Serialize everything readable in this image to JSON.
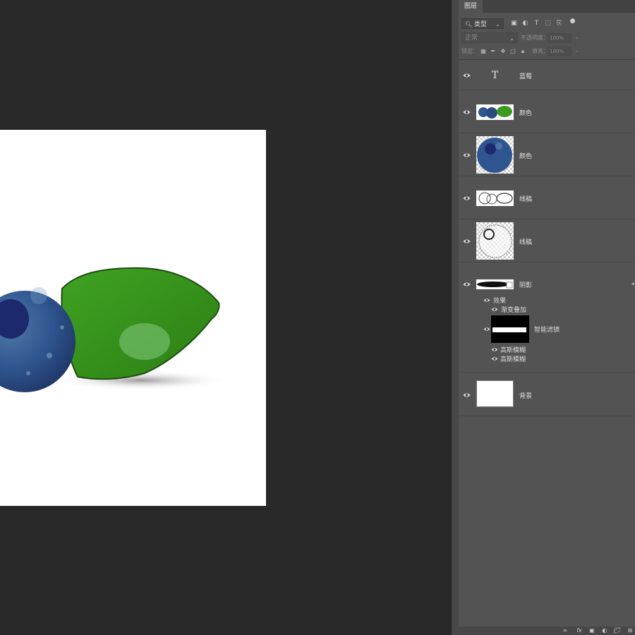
{
  "panel": {
    "tab_label": "图层",
    "filter": {
      "value": "类型",
      "icons": [
        "image-filter-icon",
        "adjustment-filter-icon",
        "type-filter-icon",
        "shape-filter-icon",
        "smart-object-filter-icon",
        "filter-toggle-icon"
      ]
    },
    "blend_mode": "正常",
    "opacity_label": "不透明度：",
    "opacity_value": "100%",
    "lock_label": "锁定：",
    "fill_label": "填充：",
    "fill_value": "100%"
  },
  "layers": [
    {
      "name": "蓝莓",
      "kind": "text",
      "visible": true,
      "thumb_glyph": "T"
    },
    {
      "name": "颜色",
      "kind": "pixel",
      "visible": true,
      "thumb": "blueberries-and-leaf"
    },
    {
      "name": "颜色",
      "kind": "pixel",
      "visible": true,
      "thumb": "blueberry"
    },
    {
      "name": "线稿",
      "kind": "pixel",
      "visible": true,
      "thumb": "sketch-wide"
    },
    {
      "name": "线稿",
      "kind": "pixel",
      "visible": true,
      "thumb": "sketch-berry"
    },
    {
      "name": "阴影",
      "kind": "smart-object",
      "visible": true,
      "thumb": "shadow-strip",
      "effects_label": "效果",
      "effects": [
        "渐变叠加"
      ],
      "smart_filter_label": "智能滤镜",
      "filters": [
        "高斯模糊",
        "高斯模糊"
      ]
    },
    {
      "name": "背景",
      "kind": "background",
      "visible": true,
      "thumb": "white"
    }
  ],
  "footer_icons": [
    "link-icon",
    "fx-icon",
    "mask-icon",
    "adjustment-icon",
    "group-folder-icon",
    "new-layer-icon"
  ],
  "colors": {
    "canvas_bg": "#282828",
    "panel_bg": "#535353",
    "leaf_green": "#3a9a1e",
    "berry_blue": "#2e4f86"
  }
}
